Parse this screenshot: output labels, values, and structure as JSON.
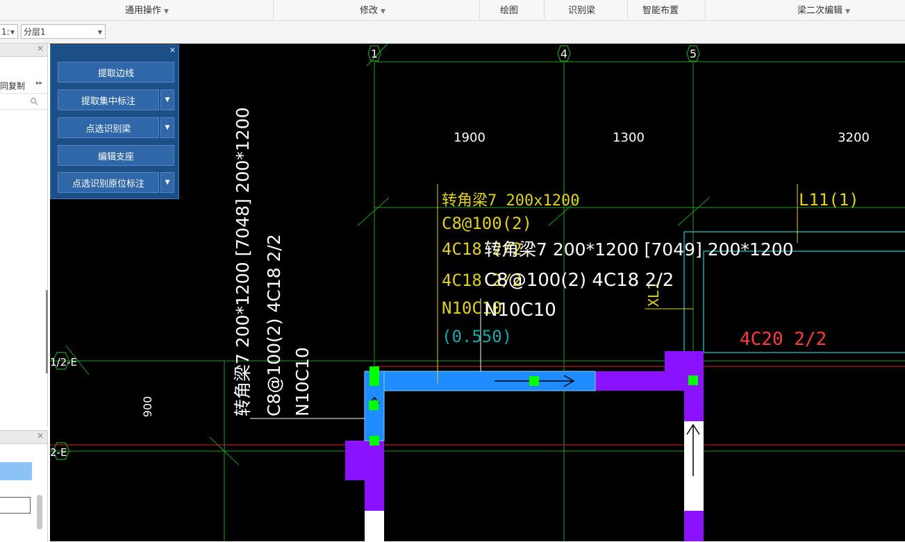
{
  "ribbon": {
    "general_ops": "通用操作",
    "modify": "修改",
    "draw": "绘图",
    "identify_beam": "识别梁",
    "smart_layout": "智能布置",
    "beam_secondary_edit": "梁二次编辑"
  },
  "toolbar": {
    "floor_combo_value": "1:",
    "layer_combo_value": "分层1"
  },
  "left_panel": {
    "copy_label": "同复制",
    "more_arrow": "▸▸"
  },
  "float_panel": {
    "extract_edge": "提取边线",
    "extract_centralized": "提取集中标注",
    "pick_identify_beam": "点选识别梁",
    "edit_support": "编辑支座",
    "pick_identify_inplace": "点选识别原位标注"
  },
  "cad": {
    "axis_labels": [
      "1",
      "4",
      "5"
    ],
    "row_axis_labels": [
      "1/2-E",
      "2-E"
    ],
    "dims": [
      "1900",
      "1300",
      "3200"
    ],
    "dim_vertical": "900",
    "vertical_beam_text": [
      "转角梁7 200*1200 [7048] 200*1200",
      "C8@100(2) 4C18 2/2",
      "N10C10"
    ],
    "yellow_annot": [
      "转角梁7 200x1200",
      "C8@100(2)",
      "4C18 2/2",
      "4C18 2/2",
      "N10C10"
    ],
    "cyan_annot": "(0.550)",
    "white_beam_text": [
      "转角梁7 200*1200 [7049] 200*1200",
      "C8@100(2) 4C18 2/2",
      "N10C10"
    ],
    "l11": "L11(1)",
    "xl_label": "XL1",
    "red_annot": "4C20 2/2"
  },
  "colors": {
    "canvas_bg": "#000000",
    "axis_green": "#1f9e1f",
    "beam_blue": "#1e8bff",
    "column_purple": "#8a12ff",
    "annot_yellow": "#e0d21a",
    "annot_red": "#ff3c3c",
    "annot_cyan": "#1aa9a9",
    "grip_green": "#00ff00",
    "panel_blue": "#1b4f86"
  }
}
